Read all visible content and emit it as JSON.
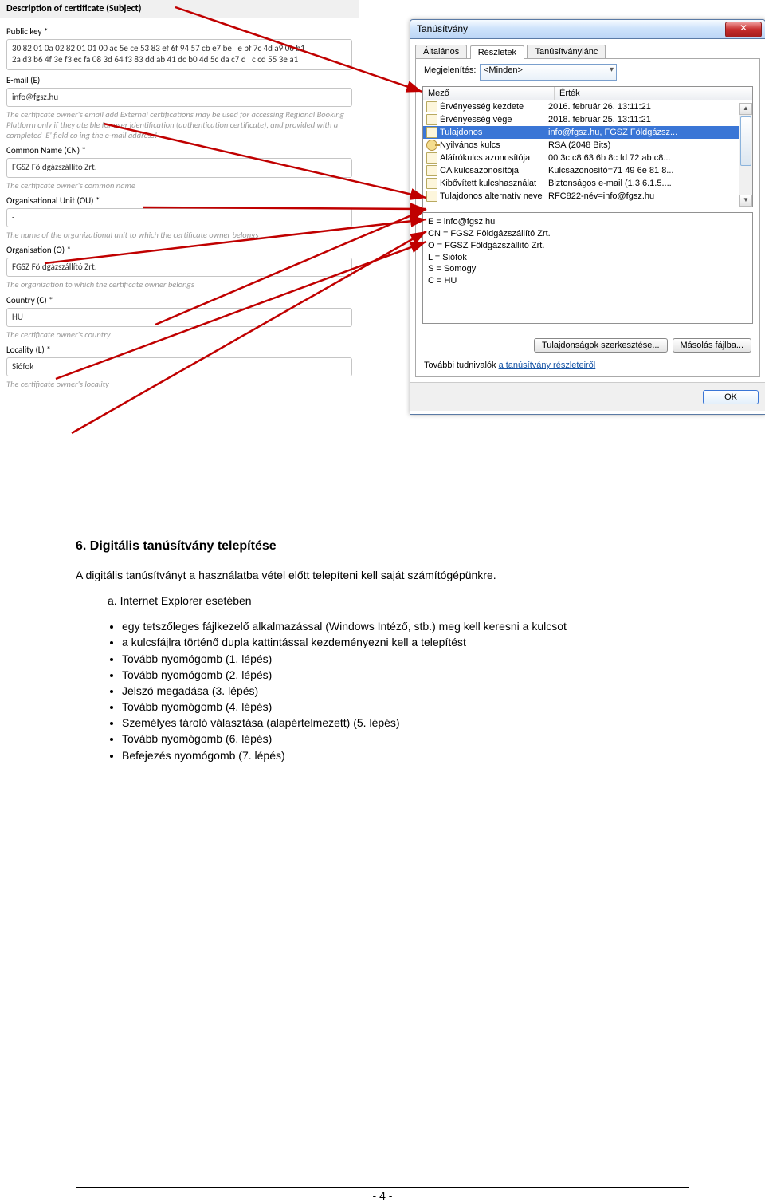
{
  "form": {
    "header": "Description of certificate (Subject)",
    "public_key": {
      "label": "Public key *",
      "value": "30 82 01 0a 02 82 01 01 00 ac 5e ce 53 83 ef 6f 94 57 cb e7 be   e bf 7c 4d a9 06 b1\n2a d3 b6 4f 3e f3 ec fa 08 3d 64 f3 83 dd ab 41 dc b0 4d 5c da c7 d   c cd 55 3e a1"
    },
    "email": {
      "label": "E-mail (E)",
      "value": "info@fgsz.hu",
      "help": "The certificate owner's email add      External certifications may be used for accessing    Regional Booking Platform only if they ate     ble for user identification (authentication certificate), and provided with a completed 'E' field co      ing the e-mail address!"
    },
    "cn": {
      "label": "Common Name (CN) *",
      "value": "FGSZ Földgázszállító Zrt.",
      "help": "The certificate owner's common name"
    },
    "ou": {
      "label": "Organisational Unit (OU) *",
      "value": "-",
      "help": "The name of the organizational unit to which the certificate owner belongs"
    },
    "o": {
      "label": "Organisation (O) *",
      "value": "FGSZ Földgázszállító Zrt.",
      "help": "The organization to which the certificate owner belongs"
    },
    "c": {
      "label": "Country (C) *",
      "value": "HU",
      "help": "The certificate owner's country"
    },
    "l": {
      "label": "Locality (L) *",
      "value": "Siófok",
      "help": "The certificate owner's locality"
    }
  },
  "cert": {
    "title": "Tanúsítvány",
    "tabs": [
      "Általános",
      "Részletek",
      "Tanúsítványlánc"
    ],
    "disp_label": "Megjelenítés:",
    "disp_value": "<Minden>",
    "col1": "Mező",
    "col2": "Érték",
    "rows": [
      {
        "f": "Érvényesség kezdete",
        "v": "2016. február 26. 13:11:21",
        "ico": "pg"
      },
      {
        "f": "Érvényesség vége",
        "v": "2018. február 25. 13:11:21",
        "ico": "pg"
      },
      {
        "f": "Tulajdonos",
        "v": "info@fgsz.hu, FGSZ Földgázsz...",
        "ico": "pg",
        "sel": true
      },
      {
        "f": "Nyilvános kulcs",
        "v": "RSA (2048 Bits)",
        "ico": "key"
      },
      {
        "f": "Aláírókulcs azonosítója",
        "v": "00 3c c8 63 6b 8c fd 72 ab c8...",
        "ico": "pg"
      },
      {
        "f": "CA kulcsazonosítója",
        "v": "Kulcsazonosító=71 49 6e 81 8...",
        "ico": "pg"
      },
      {
        "f": "Kibővített kulcshasználat",
        "v": "Biztonságos e-mail (1.3.6.1.5....",
        "ico": "pg"
      },
      {
        "f": "Tulajdonos alternatív neve",
        "v": "RFC822-név=info@fgsz.hu",
        "ico": "pg"
      }
    ],
    "detail_lines": [
      "E = info@fgsz.hu",
      "CN = FGSZ Földgázszállító Zrt.",
      "O = FGSZ Földgázszállító Zrt.",
      "L = Siófok",
      "S = Somogy",
      "C = HU"
    ],
    "btn_edit": "Tulajdonságok szerkesztése...",
    "btn_copy": "Másolás fájlba...",
    "more_text": "További tudnivalók ",
    "more_link": "a tanúsítvány részleteiről",
    "ok": "OK"
  },
  "doc": {
    "heading": "6.   Digitális tanúsítvány telepítése",
    "p1": "A digitális tanúsítványt a használatba vétel előtt telepíteni kell saját számítógépünkre.",
    "p2_lead": "a.   Internet Explorer esetében",
    "bullets": [
      "egy tetszőleges fájlkezelő alkalmazással (Windows Intéző, stb.) meg kell keresni a kulcsot",
      "a kulcsfájlra történő dupla kattintással kezdeményezni kell a telepítést",
      "Tovább nyomógomb (1. lépés)",
      "Tovább nyomógomb (2. lépés)",
      "Jelszó megadása (3. lépés)",
      "Tovább nyomógomb (4. lépés)",
      "Személyes tároló választása (alapértelmezett) (5. lépés)",
      "Tovább nyomógomb (6. lépés)",
      "Befejezés nyomógomb (7. lépés)"
    ],
    "footer": "- 4 -"
  }
}
